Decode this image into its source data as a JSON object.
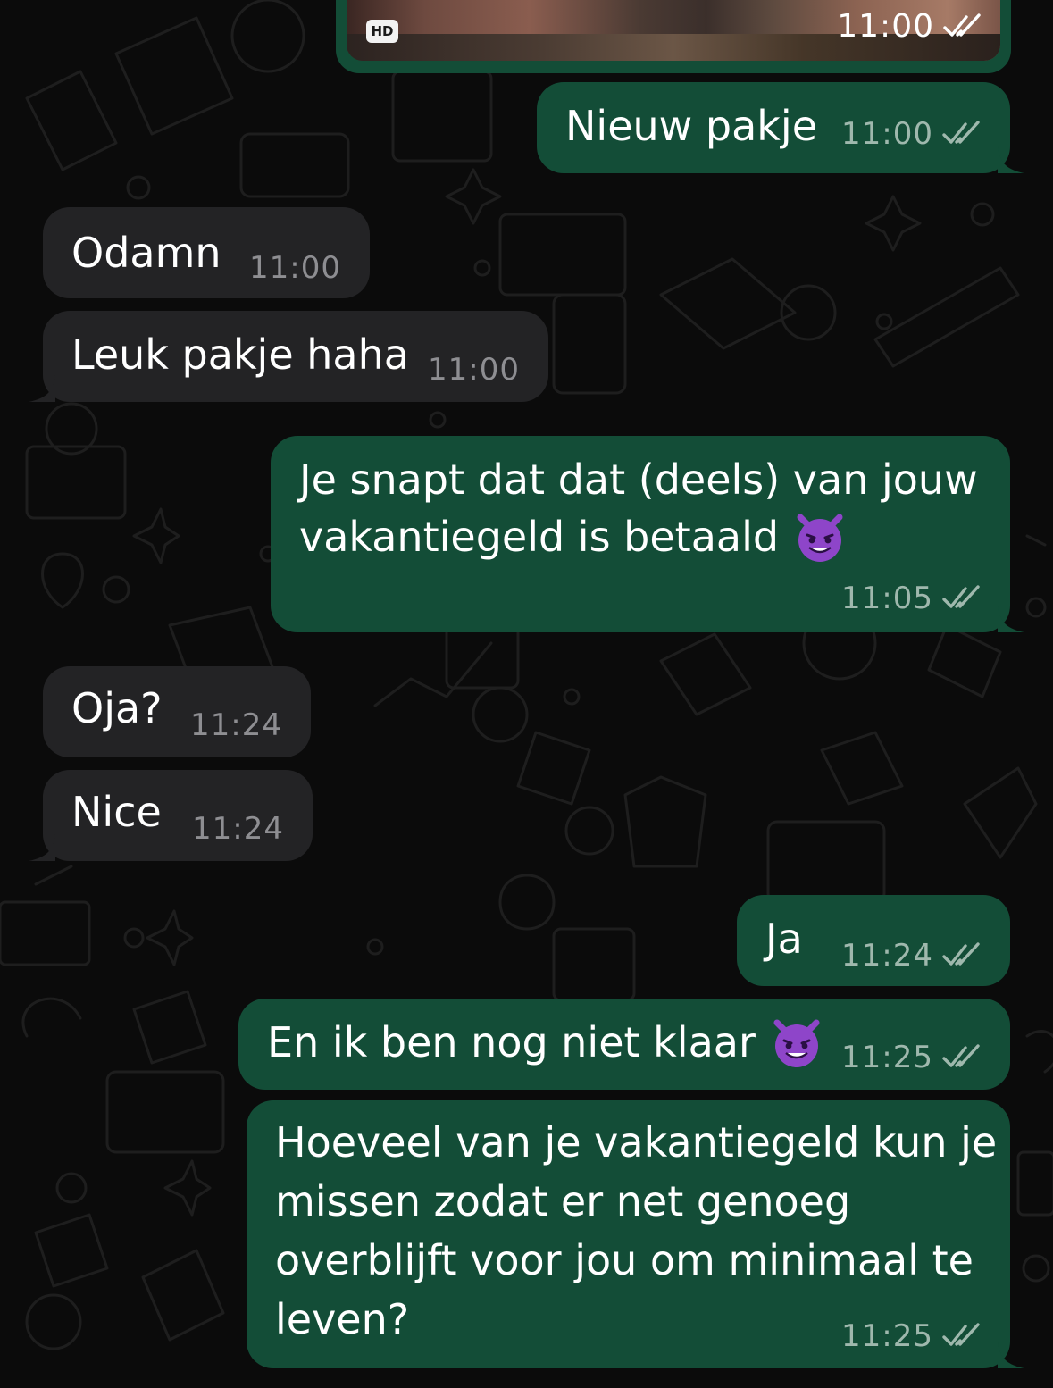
{
  "media_message": {
    "badge": "HD",
    "time": "11:00",
    "status": "read"
  },
  "messages": [
    {
      "direction": "outgoing",
      "text": "Nieuw pakje",
      "time": "11:00",
      "status": "read"
    },
    {
      "direction": "incoming",
      "text": "Odamn",
      "time": "11:00"
    },
    {
      "direction": "incoming",
      "text": "Leuk pakje haha",
      "time": "11:00"
    },
    {
      "direction": "outgoing",
      "lines": [
        "Je snapt dat dat (deels) van jouw",
        "vakantiegeld is betaald"
      ],
      "emoji": "smiling-imp",
      "time": "11:05",
      "status": "read"
    },
    {
      "direction": "incoming",
      "text": "Oja?",
      "time": "11:24"
    },
    {
      "direction": "incoming",
      "text": "Nice",
      "time": "11:24"
    },
    {
      "direction": "outgoing",
      "text": "Ja",
      "time": "11:24",
      "status": "read"
    },
    {
      "direction": "outgoing",
      "text": "En ik ben nog niet klaar",
      "emoji": "smiling-imp",
      "time": "11:25",
      "status": "read"
    },
    {
      "direction": "outgoing",
      "lines": [
        "Hoeveel van je vakantiegeld kun je",
        "missen zodat er net genoeg",
        "overblijft voor jou om minimaal te",
        "leven?"
      ],
      "time": "11:25",
      "status": "read"
    }
  ],
  "colors": {
    "background": "#0b0b0b",
    "outgoing_bubble": "#134d37",
    "incoming_bubble": "#232325",
    "read_ticks": "#9fb8ad",
    "emoji": "#8e45c9"
  }
}
